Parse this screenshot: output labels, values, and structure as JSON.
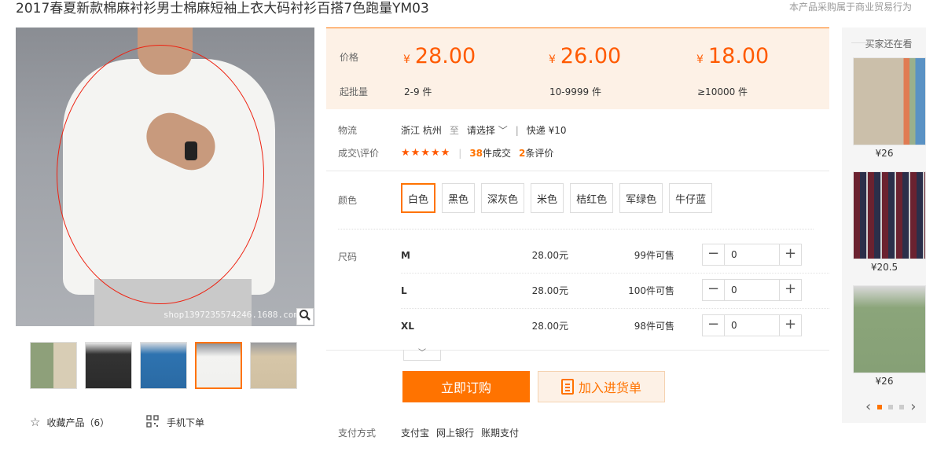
{
  "header": {
    "title": "2017春夏新款棉麻衬衫男士棉麻短袖上衣大码衬衫百搭7色跑量YM03",
    "notice": "本产品采购属于商业贸易行为"
  },
  "gallery": {
    "watermark": "shop1397235574246.1688.com",
    "zoom_icon": "magnifier-icon",
    "thumbnail_count": 5,
    "active_thumbnail": 4
  },
  "actions": {
    "favorite_label": "收藏产品（6）",
    "mobile_label": "手机下单"
  },
  "pricing": {
    "price_label": "价格",
    "moq_label": "起批量",
    "currency": "¥",
    "tiers": [
      {
        "price": "28.00",
        "range": "2-9 件"
      },
      {
        "price": "26.00",
        "range": "10-9999 件"
      },
      {
        "price": "18.00",
        "range": "≥10000 件"
      }
    ]
  },
  "logistics": {
    "label": "物流",
    "from": "浙江 杭州",
    "to_word": "至",
    "select": "请选择",
    "express": "快递 ¥10"
  },
  "deals": {
    "label": "成交\\评价",
    "stars": "★★★★★",
    "orders_count": "38",
    "orders_text": "件成交",
    "reviews_count": "2",
    "reviews_text": "条评价"
  },
  "color": {
    "label": "颜色",
    "options": [
      "白色",
      "黑色",
      "深灰色",
      "米色",
      "桔红色",
      "军绿色",
      "牛仔蓝"
    ],
    "selected_index": 0
  },
  "size": {
    "label": "尺码",
    "rows": [
      {
        "name": "M",
        "price": "28.00元",
        "stock": "99件可售",
        "qty": "0"
      },
      {
        "name": "L",
        "price": "28.00元",
        "stock": "100件可售",
        "qty": "0"
      },
      {
        "name": "XL",
        "price": "28.00元",
        "stock": "98件可售",
        "qty": "0"
      }
    ]
  },
  "buttons": {
    "buy": "立即订购",
    "cart": "加入进货单"
  },
  "payment": {
    "label": "支付方式",
    "methods": [
      "支付宝",
      "网上银行",
      "账期支付"
    ]
  },
  "sidebar": {
    "title": "买家还在看",
    "items": [
      {
        "price": "¥26"
      },
      {
        "price": "¥20.5"
      },
      {
        "price": "¥26"
      }
    ],
    "active_page": 0
  },
  "colors": {
    "accent": "#ff7300",
    "price": "#ff5a00",
    "price_bg": "#fdf1e6"
  }
}
